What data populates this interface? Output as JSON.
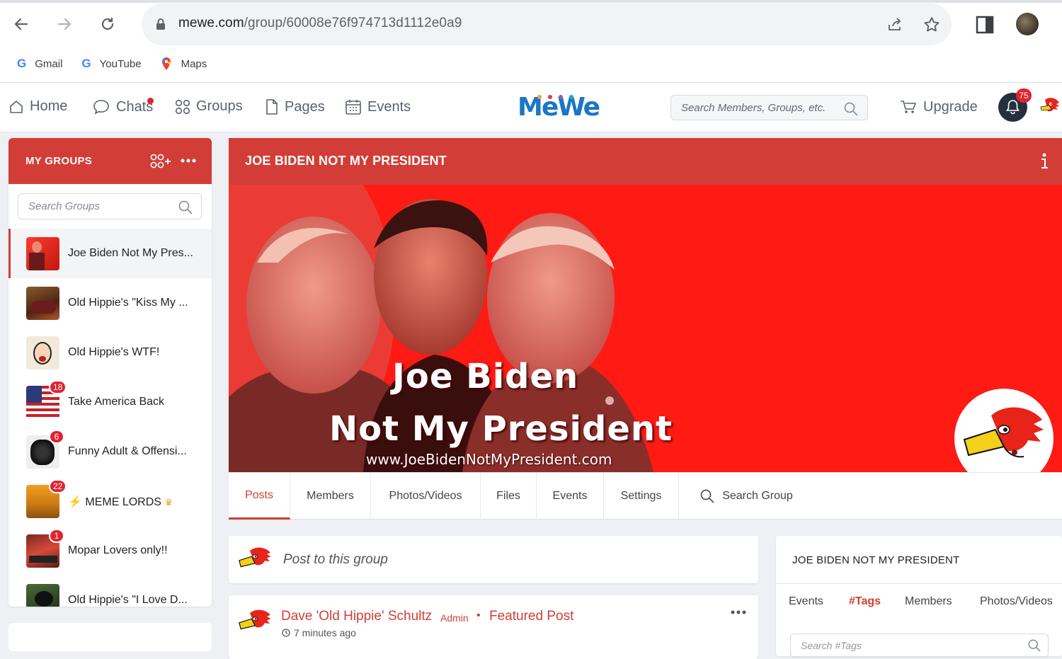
{
  "browser": {
    "url_domain": "mewe.com",
    "url_path": "/group/60008e76f974713d1112e0a9",
    "bookmarks": [
      "Gmail",
      "YouTube",
      "Maps"
    ]
  },
  "nav": {
    "home": "Home",
    "chats": "Chats",
    "groups": "Groups",
    "pages": "Pages",
    "events": "Events",
    "logo": "MeWe",
    "search_placeholder": "Search Members, Groups, etc.",
    "upgrade": "Upgrade",
    "notification_count": "75"
  },
  "sidebar": {
    "title": "MY GROUPS",
    "search_placeholder": "Search Groups",
    "groups": [
      {
        "name": "Joe Biden Not My Pres...",
        "badge": ""
      },
      {
        "name": "Old Hippie's \"Kiss My ...",
        "badge": ""
      },
      {
        "name": "Old Hippie's WTF!",
        "badge": ""
      },
      {
        "name": "Take America Back",
        "badge": "18"
      },
      {
        "name": "Funny Adult & Offensi...",
        "badge": "6"
      },
      {
        "name": "MEME LORDS",
        "badge": "22"
      },
      {
        "name": "Mopar Lovers only!!",
        "badge": "1"
      },
      {
        "name": "Old Hippie's \"I Love D...",
        "badge": ""
      }
    ]
  },
  "group": {
    "title": "JOE BIDEN NOT MY PRESIDENT",
    "banner_line1": "Joe Biden",
    "banner_line2": "Not My President",
    "banner_url": "www.JoeBidenNotMyPresident.com",
    "tabs": [
      "Posts",
      "Members",
      "Photos/Videos",
      "Files",
      "Events",
      "Settings"
    ],
    "search_tab": "Search Group"
  },
  "composer": {
    "placeholder": "Post to this group"
  },
  "post": {
    "author": "Dave 'Old Hippie' Schultz",
    "role": "Admin",
    "separator": "•",
    "featured": "Featured Post",
    "time": "7 minutes ago"
  },
  "info_card": {
    "title": "JOE BIDEN NOT MY PRESIDENT",
    "tabs": [
      "Events",
      "#Tags",
      "Members",
      "Photos/Videos"
    ],
    "search_placeholder": "Search #Tags"
  },
  "colors": {
    "accent": "#d23e37",
    "banner": "#ff1a14",
    "brand_blue": "#1b76c5"
  }
}
